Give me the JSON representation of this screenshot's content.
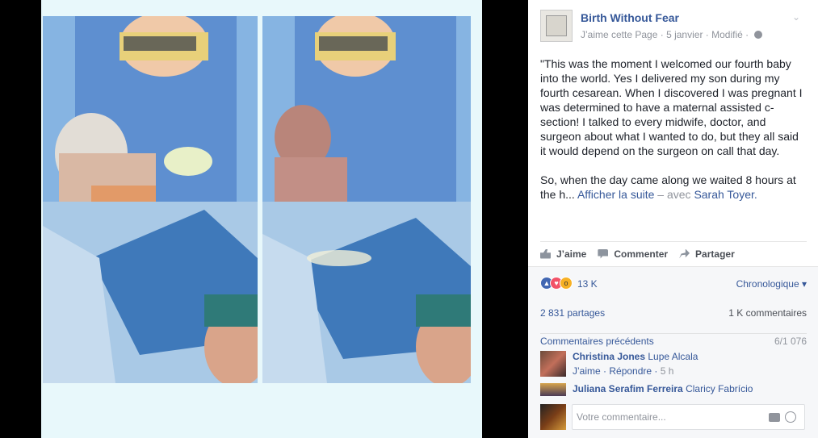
{
  "post": {
    "page_name": "Birth Without Fear",
    "like_page": "J’aime cette Page",
    "date": "5 janvier",
    "edited": "Modifié",
    "separator": "·",
    "text_p1": "\"This was the moment I welcomed our fourth baby into the world. Yes I delivered my son during my fourth cesarean. When I discovered I was pregnant I was determined to have a maternal assisted c-section! I talked to every midwife, doctor, and surgeon about what I wanted to do, but they all said it would depend on the surgeon on call that day.",
    "text_p2": "So, when the day came along we waited 8 hours at the h...",
    "see_more": "Afficher la suite",
    "with_label": "– avec",
    "tagged_user": "Sarah Toyer."
  },
  "actions": {
    "like": "J’aime",
    "comment": "Commenter",
    "share": "Partager"
  },
  "stats": {
    "reaction_count": "13 K",
    "sort": "Chronologique ▾",
    "shares": "2 831 partages",
    "comments": "1 K commentaires",
    "previous_comments": "Commentaires précédents",
    "comment_position": "6/1 076"
  },
  "comments": [
    {
      "author": "Christina Jones",
      "tagged": "Lupe Alcala",
      "like": "J’aime",
      "reply": "Répondre",
      "time": "5 h"
    },
    {
      "author": "Juliana Serafim Ferreira",
      "tagged": "Claricy Fabrício"
    }
  ],
  "compose": {
    "placeholder": "Votre commentaire..."
  },
  "icons": [
    "globe-icon",
    "chevron-down-icon",
    "like-icon",
    "comment-icon",
    "share-icon",
    "camera-icon",
    "emoji-icon"
  ],
  "colors": {
    "link": "#365899",
    "text": "#1d2129",
    "muted": "#90949c",
    "photo_background": "#000000"
  }
}
